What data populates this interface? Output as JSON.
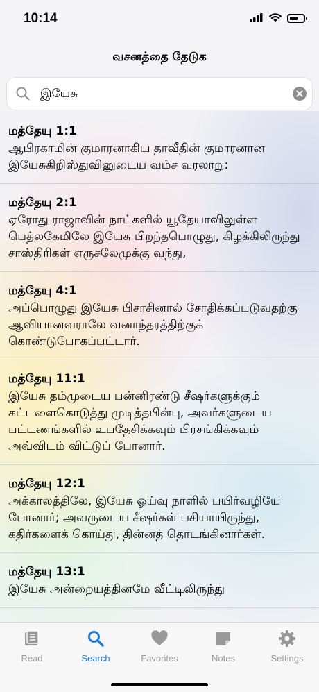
{
  "status_bar": {
    "time": "10:14"
  },
  "nav": {
    "title": "வசனத்தை தேடுக"
  },
  "search": {
    "value": "இயேசு"
  },
  "results": [
    {
      "ref": "மத்தேயு 1:1",
      "text": "ஆபிரகாமின் குமாரனாகிய தாவீதின் குமாரனான இயேசுகிறிஸ்துவினுடைய வம்ச வரலாறு:"
    },
    {
      "ref": "மத்தேயு 2:1",
      "text": "ஏரோது ராஜாவின் நாட்களில் யூதேயாவிலுள்ள பெத்லகேமிலே இயேசு பிறந்தபொழுது, கிழக்கிலிருந்து சாஸ்திரிகள் எருசலேமுக்கு வந்து,"
    },
    {
      "ref": "மத்தேயு 4:1",
      "text": "அப்பொழுது இயேசு பிசாசினால் சோதிக்கப்படுவதற்கு ஆவியானவராலே வனாந்தரத்திற்குக் கொண்டுபோகப்பட்டார்."
    },
    {
      "ref": "மத்தேயு 11:1",
      "text": "இயேசு தம்முடைய பன்னிரண்டு சீஷர்களுக்கும் கட்டளைகொடுத்து முடித்தபின்பு, அவர்களுடைய பட்டணங்களில் உபதேசிக்கவும் பிரசங்கிக்கவும் அவ்விடம் விட்டுப் போனார்."
    },
    {
      "ref": "மத்தேயு 12:1",
      "text": "அக்காலத்திலே, இயேசு ஓய்வு நாளில் பயிர்வழியே போனார்; அவருடைய சீஷர்கள் பசியாயிருந்து, கதிர்களைக் கொய்து, தின்னத் தொடங்கினார்கள்."
    },
    {
      "ref": "மத்தேயு 13:1",
      "text": "இயேசு அன்றையத்தினமே வீட்டிலிருந்து"
    }
  ],
  "tabs": [
    {
      "label": "Read",
      "icon": "book-icon",
      "active": false
    },
    {
      "label": "Search",
      "icon": "search-icon",
      "active": true
    },
    {
      "label": "Favorites",
      "icon": "heart-icon",
      "active": false
    },
    {
      "label": "Notes",
      "icon": "note-icon",
      "active": false
    },
    {
      "label": "Settings",
      "icon": "gear-icon",
      "active": false
    }
  ],
  "colors": {
    "accent": "#1e7bd8",
    "inactive": "#999999"
  }
}
